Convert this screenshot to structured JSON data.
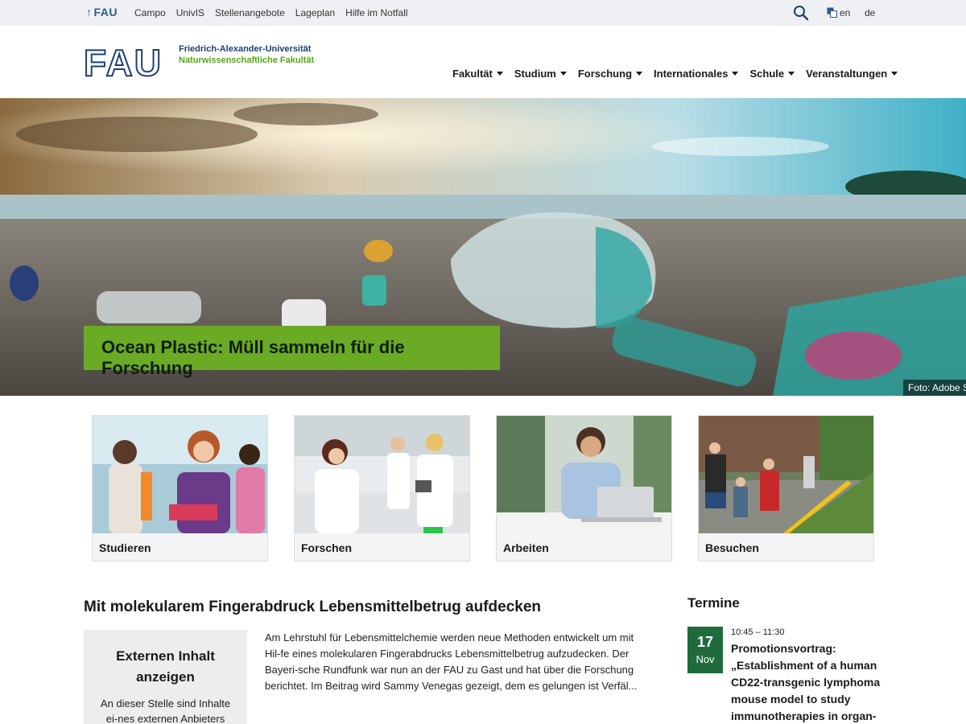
{
  "topbar": {
    "brand": "FAU",
    "links": [
      "Campo",
      "UnivIS",
      "Stellenangebote",
      "Lageplan",
      "Hilfe im Notfall"
    ],
    "lang_en": "en",
    "lang_de": "de"
  },
  "header": {
    "logo_text": "FAU",
    "university": "Friedrich-Alexander-Universität",
    "faculty": "Naturwissenschaftliche Fakultät",
    "nav": [
      "Fakultät",
      "Studium",
      "Forschung",
      "Internationales",
      "Schule",
      "Veranstaltungen"
    ]
  },
  "hero": {
    "caption": "Ocean Plastic: Müll sammeln für die Forschung",
    "credit": "Foto: Adobe S"
  },
  "cards": [
    {
      "label": "Studieren"
    },
    {
      "label": "Forschen"
    },
    {
      "label": "Arbeiten"
    },
    {
      "label": "Besuchen"
    }
  ],
  "article": {
    "title": "Mit molekularem Fingerabdruck Lebensmittelbetrug aufdecken",
    "external_heading": "Externen Inhalt anzeigen",
    "external_text": "An dieser Stelle sind Inhalte ei-nes externen Anbieters (ARD",
    "text": "Am Lehrstuhl für Lebensmittelchemie werden neue Methoden entwickelt um mit Hil-fe eines molekularen Fingerabdrucks Lebensmittelbetrug aufzudecken. Der Bayeri-sche Rundfunk war nun an der FAU zu Gast und hat über die Forschung berichtet. Im Beitrag wird Sammy Venegas gezeigt, dem es gelungen ist Verfäl..."
  },
  "termine": {
    "title": "Termine",
    "event": {
      "day": "17",
      "month": "Nov",
      "time": "10:45 – 11:30",
      "title": "Promotionsvortrag: „Establishment of a human CD22-transgenic lymphoma mouse model to study immunotherapies in organ-"
    }
  },
  "colors": {
    "accent_green": "#6aaa25",
    "date_green": "#1f6b3c",
    "fau_blue": "#1d3f72",
    "topbar_bg": "#eef0f3"
  }
}
